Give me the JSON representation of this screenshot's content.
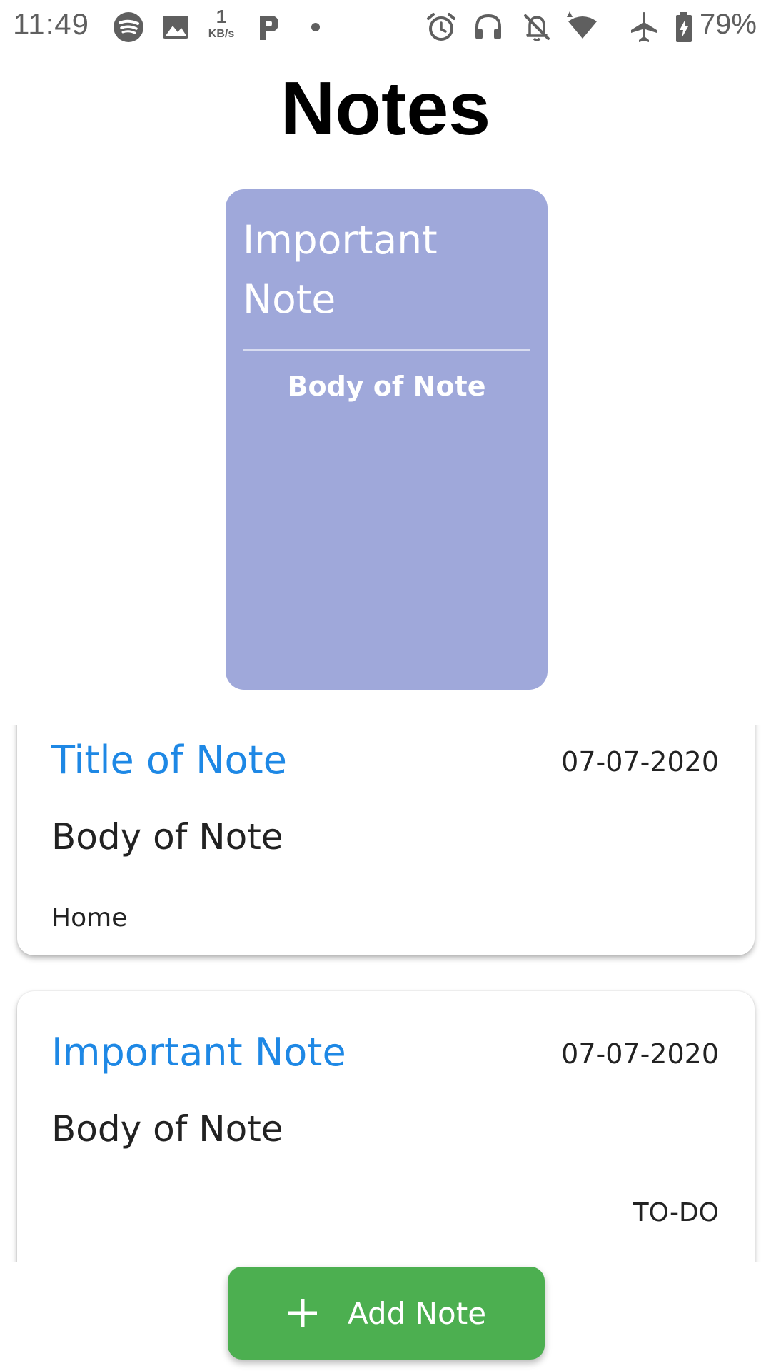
{
  "status_bar": {
    "time": "11:49",
    "net_speed_value": "1",
    "net_speed_unit": "KB/s",
    "battery_percent": "79%",
    "icons": [
      "spotify-icon",
      "gallery-icon",
      "kbs-indicator",
      "p-app-icon",
      "dot-icon",
      "alarm-icon",
      "headphones-icon",
      "notifications-off-icon",
      "wifi-icon",
      "airplane-icon",
      "battery-charging-icon"
    ]
  },
  "header": {
    "title": "Notes"
  },
  "featured_note": {
    "title": "Important Note",
    "body": "Body of Note",
    "color": "#9fa8da"
  },
  "notes": [
    {
      "title": "Title of Note",
      "date": "07-07-2020",
      "body": "Body of Note",
      "tag": "Home"
    },
    {
      "title": "Important Note",
      "date": "07-07-2020",
      "body": "Body of Note",
      "tag": "TO-DO"
    }
  ],
  "add_button": {
    "label": "Add Note",
    "icon": "plus-icon",
    "color": "#4caf50"
  },
  "colors": {
    "note_title": "#1e88e5",
    "status_text": "#5f5f5f"
  }
}
